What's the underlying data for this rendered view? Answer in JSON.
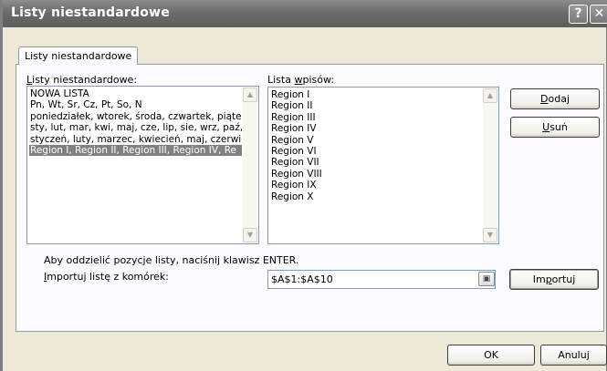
{
  "window": {
    "title": "Listy niestandardowe",
    "help_icon_glyph": "?",
    "close_icon_glyph": "✕"
  },
  "tab": {
    "label": "Listy niestandardowe"
  },
  "custom_lists": {
    "label_pre": "",
    "label_accel": "L",
    "label_post": "isty niestandardowe:",
    "items": [
      "NOWA LISTA",
      "Pn, Wt, Śr, Cz, Pt, So, N",
      "poniedziałek, wtorek, środa, czwartek, piątek",
      "sty, lut, mar, kwi, maj, cze, lip, sie, wrz, paź,",
      "styczeń, luty, marzec, kwiecień, maj, czerwiec",
      "Region I, Region II, Region III, Region IV, Re"
    ],
    "selected_index": 5
  },
  "entries": {
    "label_pre": "Lista ",
    "label_accel": "w",
    "label_post": "pisów:",
    "items": [
      "Region I",
      "Region II",
      "Region III",
      "Region IV",
      "Region V",
      "Region VI",
      "Region VII",
      "Region VIII",
      "Region IX",
      "Region X"
    ]
  },
  "buttons": {
    "add_pre": "",
    "add_accel": "D",
    "add_post": "odaj",
    "delete_pre": "",
    "delete_accel": "U",
    "delete_post": "suń",
    "import_pre": "Im",
    "import_accel": "p",
    "import_post": "ortuj",
    "ok": "OK",
    "cancel": "Anuluj"
  },
  "hint_text": "Aby oddzielić pozycje listy, naciśnij klawisz ENTER.",
  "import_from": {
    "label_pre": "",
    "label_accel": "I",
    "label_post": "mportuj listę z komórek:",
    "value": "$A$1:$A$10"
  },
  "icons": {
    "help": "help-icon",
    "close": "close-icon",
    "scroll_up": "scroll-up-arrow-icon",
    "scroll_down": "scroll-down-arrow-icon",
    "collapse_dialog": "collapse-dialog-icon"
  }
}
